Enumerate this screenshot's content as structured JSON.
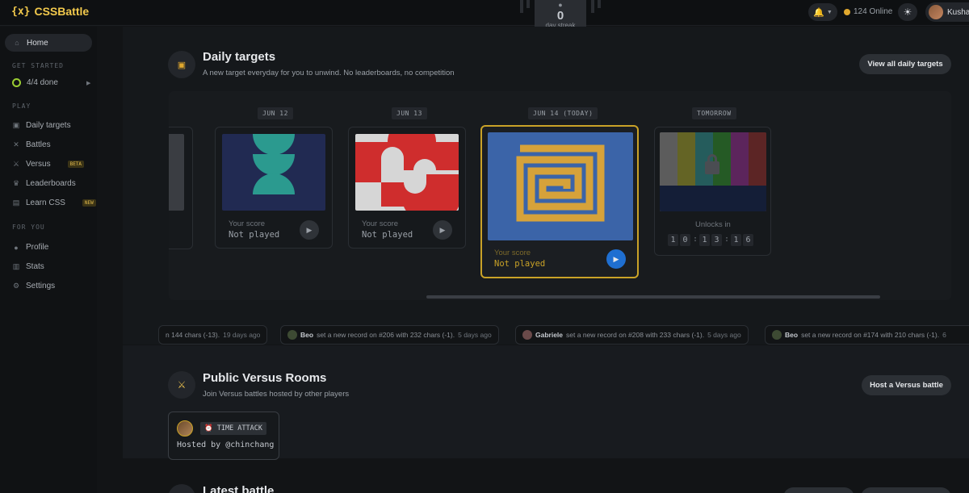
{
  "app": {
    "logo_mark": "{x}",
    "name": "CSSBattle"
  },
  "streak": {
    "count": "0",
    "label": "day streak"
  },
  "topbar": {
    "online": "124 Online",
    "username": "Kusha"
  },
  "sidebar": {
    "home": "Home",
    "get_started_heading": "GET STARTED",
    "progress": "4/4 done",
    "play_heading": "PLAY",
    "items": [
      {
        "label": "Daily targets"
      },
      {
        "label": "Battles"
      },
      {
        "label": "Versus",
        "badge": "BETA"
      },
      {
        "label": "Leaderboards"
      },
      {
        "label": "Learn CSS",
        "badge": "NEW"
      }
    ],
    "for_you_heading": "FOR YOU",
    "personal": [
      {
        "label": "Profile"
      },
      {
        "label": "Stats"
      },
      {
        "label": "Settings"
      }
    ]
  },
  "daily": {
    "title": "Daily targets",
    "subtitle": "A new target everyday for you to unwind. No leaderboards, no competition",
    "view_all": "View all daily targets",
    "cards": [
      {
        "date": "JUN 12",
        "score_label": "Your score",
        "score": "Not played"
      },
      {
        "date": "JUN 13",
        "score_label": "Your score",
        "score": "Not played"
      },
      {
        "date": "JUN 14 (TODAY)",
        "score_label": "Your score",
        "score": "Not played"
      },
      {
        "date": "TOMORROW",
        "unlock_label": "Unlocks in",
        "countdown": [
          "1",
          "0",
          "1",
          "3",
          "1",
          "6"
        ]
      }
    ]
  },
  "ticker": [
    {
      "text": "n 144 chars (-13).",
      "ago": "19 days ago"
    },
    {
      "user": "Beo",
      "text": "set a new record on #206 with 232 chars (-1).",
      "ago": "5 days ago"
    },
    {
      "user": "Gabriele",
      "text": "set a new record on #208 with 233 chars (-1).",
      "ago": "5 days ago"
    },
    {
      "user": "Beo",
      "text": "set a new record on #174 with 210 chars (-1).",
      "ago": "6"
    }
  ],
  "versus": {
    "title": "Public Versus Rooms",
    "subtitle": "Join Versus battles hosted by other players",
    "host_button": "Host a Versus battle",
    "room": {
      "mode": "TIME ATTACK",
      "host": "Hosted by @chinchang"
    }
  },
  "latest": {
    "title": "Latest battle"
  },
  "colors": {
    "accent": "#f2c94c",
    "today_border": "#c9a227",
    "play_blue": "#1f6fd1"
  }
}
